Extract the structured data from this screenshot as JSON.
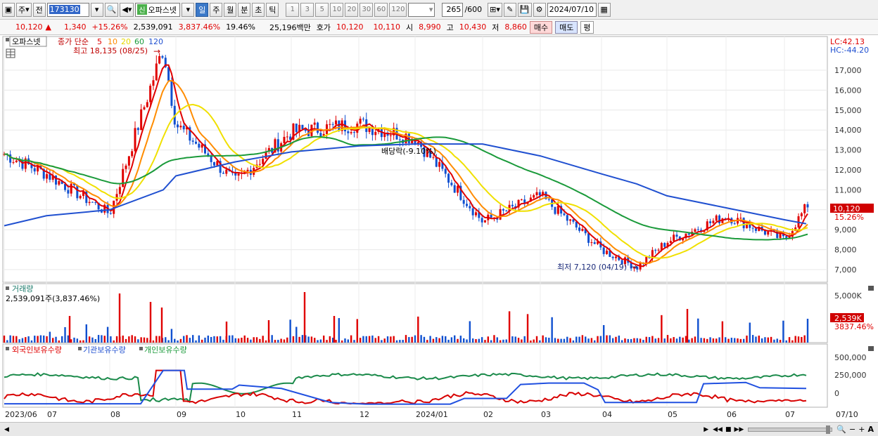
{
  "toolbar": {
    "market_label": "주",
    "prev_label": "전",
    "code": "173130",
    "stock_badge": "신",
    "stock_name": "오파스넷",
    "period_day": "일",
    "period_week": "주",
    "period_month": "월",
    "period_minute": "분",
    "period_second": "초",
    "period_tick": "틱",
    "intervals": [
      "1",
      "3",
      "5",
      "10",
      "20",
      "30",
      "60",
      "120"
    ],
    "count": "265",
    "count_total": "/600",
    "date": "2024/07/10"
  },
  "quote": {
    "price": "10,120",
    "change": "1,340",
    "change_pct": "+15.26%",
    "volume": "2,539,091",
    "volume_pct": "3,837.46%",
    "turnover": "19.46%",
    "amount": "25,196백만",
    "ask_label": "호가",
    "ask": "10,120",
    "bid": "10,110",
    "open_label": "시",
    "open": "8,990",
    "high_label": "고",
    "high": "10,430",
    "low_label": "저",
    "low": "8,860",
    "buy_label": "매수",
    "sell_label": "매도",
    "pyeong_label": "평"
  },
  "price_panel": {
    "stock_label": "오파스넷",
    "ma_label": "종가 단순",
    "ma_periods": [
      "5",
      "10",
      "20",
      "60",
      "120"
    ],
    "high_annotation": "최고 18,135 (08/25)",
    "low_annotation": "최저 7,120 (04/19)",
    "dividend_annotation": "배당락(-9.10%)",
    "lc": "LC:42.13",
    "hc": "HC:-44.20",
    "current_price_tag": "10,120",
    "current_pct_tag": "15.26%",
    "y_ticks": [
      "17,000",
      "16,000",
      "15,000",
      "14,000",
      "13,000",
      "12,000",
      "11,000",
      "10,000",
      "9,000",
      "8,000",
      "7,000"
    ]
  },
  "volume_panel": {
    "title": "거래량",
    "info": "2,539,091주(3,837.46%)",
    "y_tick": "5,000K",
    "current_tag": "2,539K",
    "current_pct": "3837.46%"
  },
  "holdings_panel": {
    "foreign": "외국인보유수량",
    "institution": "기관보유수량",
    "individual": "개인보유수량",
    "y_ticks": [
      "500,000",
      "250,000",
      "0"
    ]
  },
  "x_axis": [
    "2023/06",
    "07",
    "08",
    "09",
    "10",
    "11",
    "12",
    "2024/01",
    "02",
    "03",
    "04",
    "05",
    "06",
    "07",
    "07/10"
  ],
  "chart_data": [
    {
      "type": "line",
      "title": "오파스넷",
      "x": [
        "2023/06",
        "07",
        "08",
        "08/25",
        "09",
        "10",
        "11",
        "12",
        "2024/01",
        "02",
        "03",
        "04",
        "04/19",
        "05",
        "06",
        "07",
        "07/10"
      ],
      "series": [
        {
          "name": "종가",
          "values": [
            12800,
            11800,
            9800,
            18135,
            14300,
            11400,
            13900,
            14300,
            13600,
            9400,
            10700,
            8000,
            7120,
            8400,
            9700,
            8500,
            10120
          ]
        },
        {
          "name": "120",
          "values": [
            9200,
            9700,
            10000,
            11000,
            11700,
            12400,
            12900,
            13200,
            13300,
            13300,
            12700,
            11800,
            11300,
            10700,
            10100,
            9500,
            9300
          ]
        }
      ],
      "ylim": [
        6500,
        17800
      ],
      "annotations": [
        "최고 18,135 (08/25)",
        "최저 7,120 (04/19)",
        "배당락(-9.10%)"
      ]
    },
    {
      "type": "bar",
      "title": "거래량",
      "values_note": "daily volume",
      "last_value": 2539091,
      "ylim": [
        0,
        6000000
      ]
    }
  ]
}
